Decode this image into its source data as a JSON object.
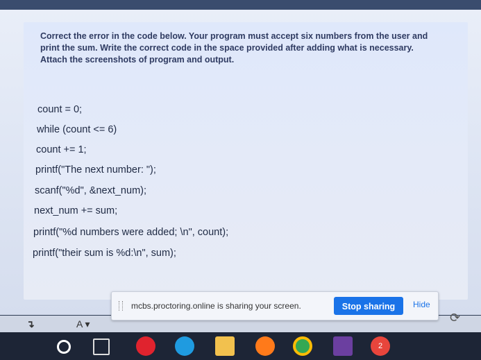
{
  "question": {
    "instructions": [
      "Correct the error in the code below. Your program must accept six numbers from the user and",
      "print the sum. Write the correct code in the space provided after adding what is necessary.",
      "Attach the screenshots of program and output."
    ],
    "code": [
      "count = 0;",
      "while (count <= 6)",
      "count += 1;",
      "printf(\"The next number: \");",
      "scanf(\"%d\", &next_num);",
      "next_num += sum;",
      "printf(\"%d numbers were added; \\n\", count);",
      "printf(\"their sum is %d:\\n\", sum);"
    ]
  },
  "share_bar": {
    "message": "mcbs.proctoring.online is sharing your screen.",
    "stop_label": "Stop sharing",
    "hide_label": "Hide"
  },
  "editor_toolbar": {
    "font_color_label": "A",
    "undo_glyph": "↴"
  },
  "taskbar": {
    "icons": [
      "start-icon",
      "task-view-icon",
      "opera-icon",
      "edge-icon",
      "file-explorer-icon",
      "firefox-icon",
      "chrome-icon",
      "visual-studio-icon",
      "app-badge-icon"
    ],
    "badge_count": "2"
  }
}
